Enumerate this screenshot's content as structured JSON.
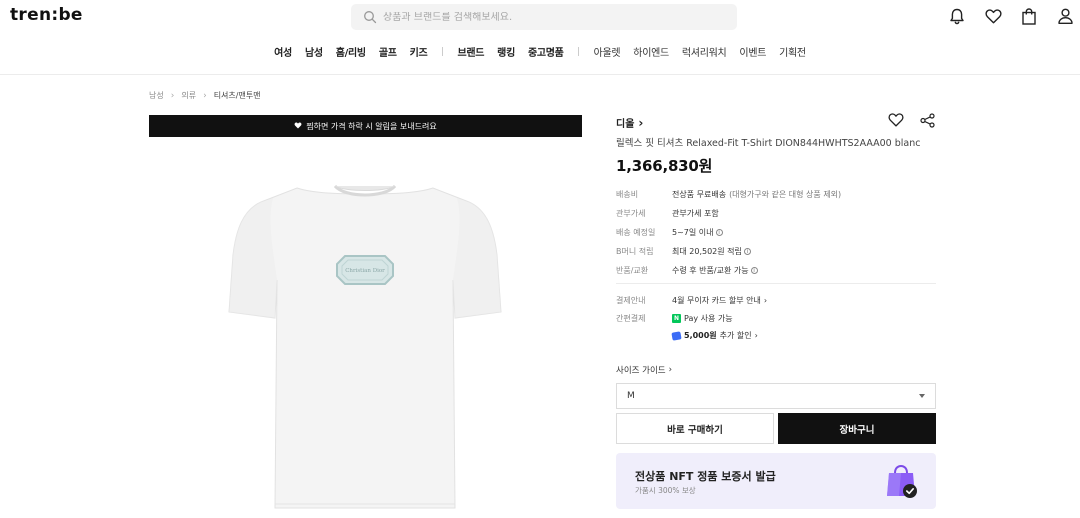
{
  "header": {
    "logo": "tren:be",
    "search_placeholder": "상품과 브랜드를 검색해보세요.",
    "icons": [
      "bell-icon",
      "heart-icon",
      "bag-icon",
      "user-icon"
    ]
  },
  "nav": {
    "primary": [
      "여성",
      "남성",
      "홈/리빙",
      "골프",
      "키즈"
    ],
    "secondary": [
      "브랜드",
      "랭킹",
      "중고명품"
    ],
    "tertiary": [
      "아울렛",
      "하이엔드",
      "럭셔리워치",
      "이벤트",
      "기획전"
    ]
  },
  "breadcrumb": [
    "남성",
    "의류",
    "티셔츠/맨투맨"
  ],
  "alert_banner": "찜하면 가격 하락 시 알림을 보내드려요",
  "product": {
    "brand": "디올",
    "name": "릴렉스 핏 티셔츠 Relaxed-Fit T-Shirt DION844HWHTS2AAA00 blanc",
    "price": "1,366,830원",
    "image_label": "Christian Dior"
  },
  "meta": {
    "shipping_label": "배송비",
    "shipping_value": "전상품 무료배송",
    "shipping_sub": "(대형가구와 같은 대형 상품 제외)",
    "tax_label": "관부가세",
    "tax_value": "관부가세 포함",
    "eta_label": "배송 예정일",
    "eta_value": "5~7일 이내",
    "points_label": "B머니 적립",
    "points_value": "최대 20,502원 적립",
    "return_label": "반품/교환",
    "return_value": "수령 후 반품/교환 가능",
    "payment_label": "결제안내",
    "payment_value": "4월 무이자 카드 할부 안내",
    "easypay_label": "간편결제",
    "easypay_badge": "N",
    "easypay_value": "Pay 사용 가능",
    "coupon_amount": "5,000원",
    "coupon_text": "추가 할인"
  },
  "size": {
    "guide_label": "사이즈 가이드",
    "selected": "M"
  },
  "buttons": {
    "buy_now": "바로 구매하기",
    "cart": "장바구니"
  },
  "nft": {
    "title": "전상품 NFT 정품 보증서 발급",
    "subtitle": "가품시 300% 보상"
  },
  "colors": {
    "accent_dark": "#111111",
    "nft_bg": "#f0eefb",
    "naver_green": "#03c75a",
    "nft_bag": "#8b5cf6"
  }
}
